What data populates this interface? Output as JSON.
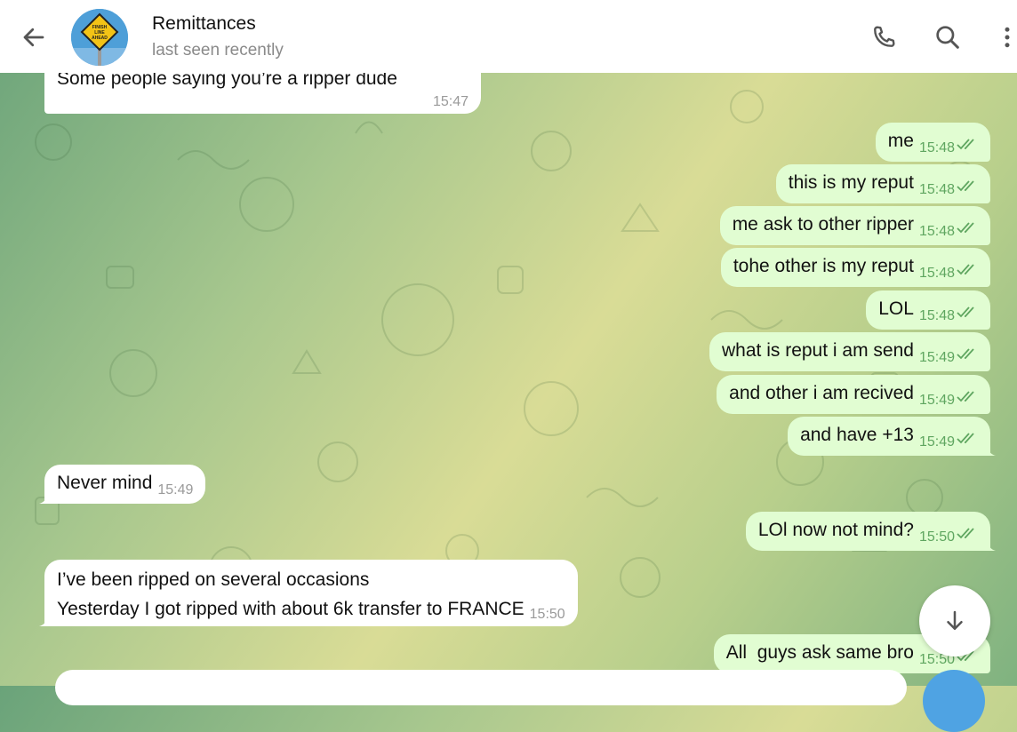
{
  "header": {
    "back_icon": "arrow-left-icon",
    "chat_title": "Remittances",
    "status": "last seen recently",
    "avatar_sign_text": "FINISH LINE AHEAD",
    "call_icon": "phone-icon",
    "search_icon": "search-icon",
    "menu_icon": "more-vertical-icon"
  },
  "messages": [
    {
      "dir": "in",
      "text": "Some people saying you’re a ripper dude",
      "time": "15:47"
    },
    {
      "dir": "out",
      "text": "me",
      "time": "15:48"
    },
    {
      "dir": "out",
      "text": "this is my reput",
      "time": "15:48"
    },
    {
      "dir": "out",
      "text": "me ask to other ripper",
      "time": "15:48"
    },
    {
      "dir": "out",
      "text": "tohe other is my reput",
      "time": "15:48"
    },
    {
      "dir": "out",
      "text": "LOL",
      "time": "15:48"
    },
    {
      "dir": "out",
      "text": "what is reput i am send",
      "time": "15:49"
    },
    {
      "dir": "out",
      "text": "and other i am recived",
      "time": "15:49"
    },
    {
      "dir": "out",
      "text": "and have +13",
      "time": "15:49"
    },
    {
      "dir": "in",
      "text": "Never mind",
      "time": "15:49"
    },
    {
      "dir": "out",
      "text": "LOl now not mind?",
      "time": "15:50"
    },
    {
      "dir": "in",
      "line1": "I’ve been ripped on several occasions",
      "line2": "Yesterday I got ripped with about 6k transfer to FRANCE",
      "time": "15:50"
    },
    {
      "dir": "out",
      "text": "All  guys ask same bro",
      "time": "15:50"
    }
  ],
  "scroll_down_icon": "arrow-down-icon",
  "colors": {
    "incoming": "#ffffff",
    "outgoing": "#e1fdd2",
    "read_check": "#5fa660",
    "accent": "#4fa3e3"
  }
}
